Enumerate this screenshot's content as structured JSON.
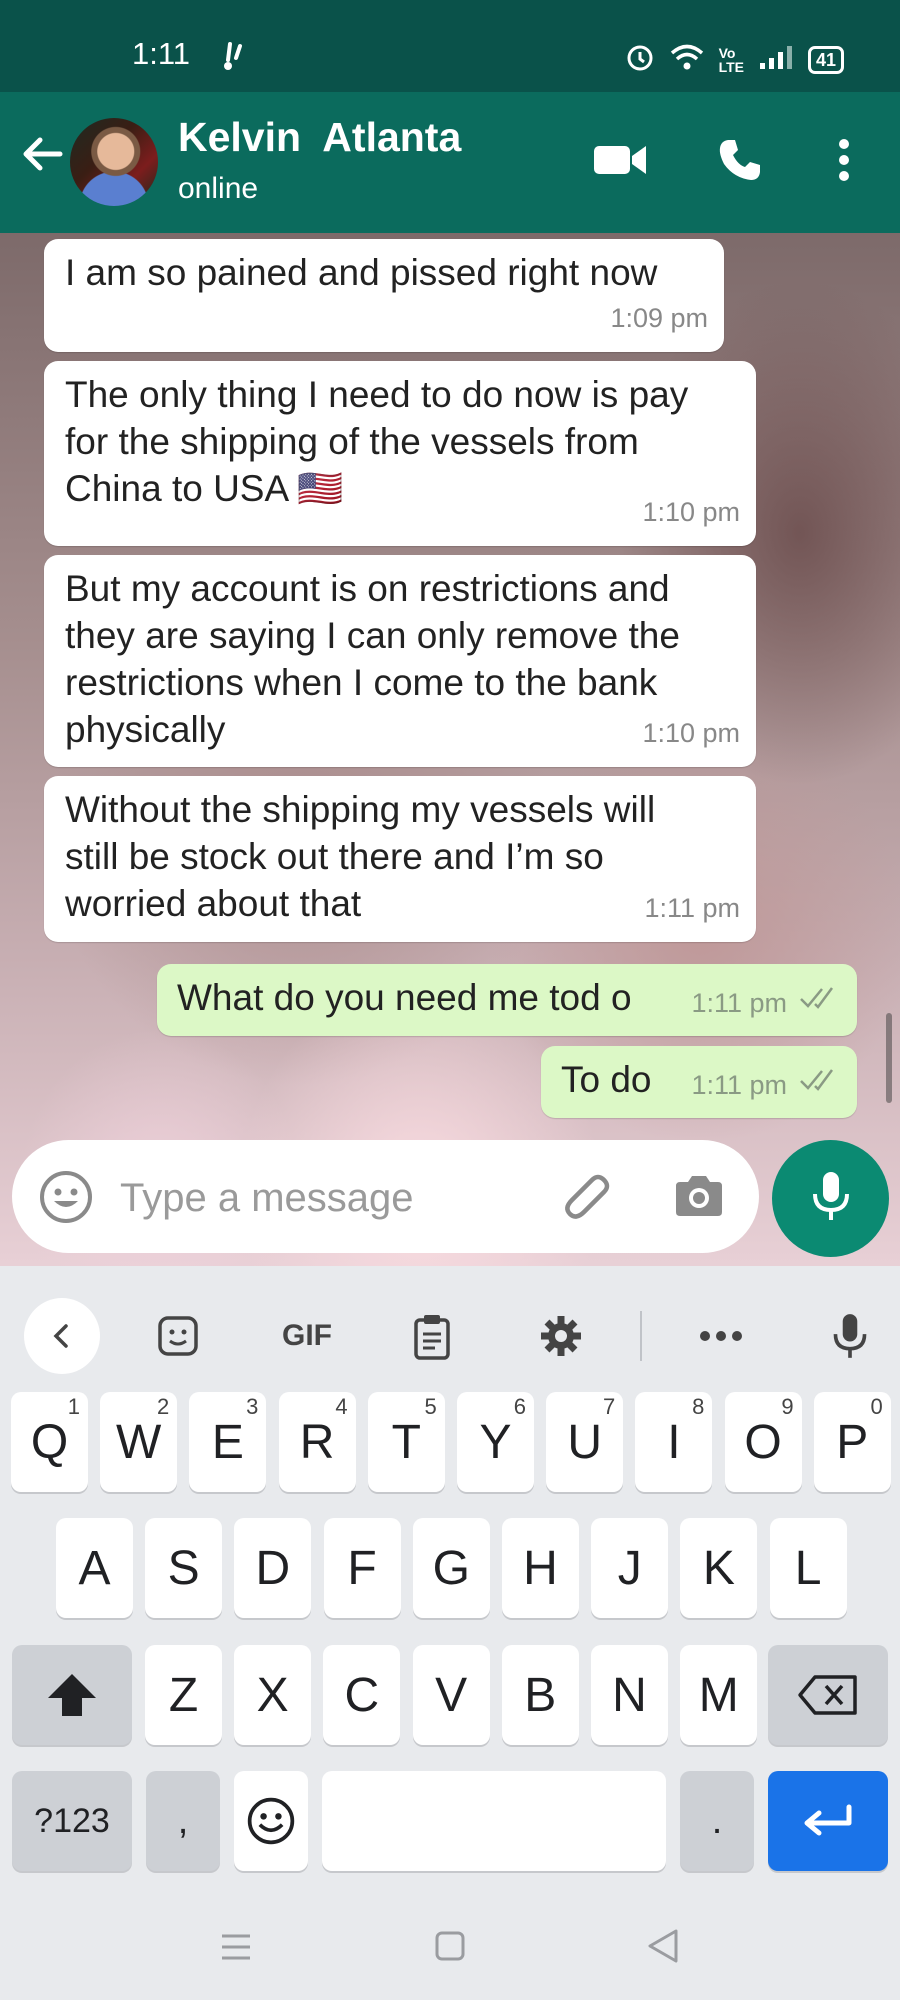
{
  "status_bar": {
    "time": "1:11",
    "battery": "41"
  },
  "header": {
    "contact_name": "Kelvin  Atlanta",
    "contact_status": "online"
  },
  "messages": [
    {
      "direction": "in",
      "text": "I am so pained and pissed right now",
      "time": "1:09 pm"
    },
    {
      "direction": "in",
      "text": "The only thing I need to do now is pay\nfor the shipping of the vessels from\nChina to USA 🇺🇸",
      "time": "1:10 pm"
    },
    {
      "direction": "in",
      "text": "But my account is on restrictions and\nthey are saying I can only remove the\nrestrictions when I come to the bank\nphysically",
      "time": "1:10 pm"
    },
    {
      "direction": "in",
      "text": "Without the shipping my vessels will\nstill be stock out there and I’m so\nworried about that",
      "time": "1:11 pm"
    },
    {
      "direction": "out",
      "text": "What do you need me tod o",
      "time": "1:11 pm"
    },
    {
      "direction": "out",
      "text": "To do",
      "time": "1:11 pm"
    }
  ],
  "composer": {
    "placeholder": "Type a message"
  },
  "keyboard": {
    "toolbar": {
      "gif": "GIF"
    },
    "row1": [
      {
        "k": "Q",
        "h": "1"
      },
      {
        "k": "W",
        "h": "2"
      },
      {
        "k": "E",
        "h": "3"
      },
      {
        "k": "R",
        "h": "4"
      },
      {
        "k": "T",
        "h": "5"
      },
      {
        "k": "Y",
        "h": "6"
      },
      {
        "k": "U",
        "h": "7"
      },
      {
        "k": "I",
        "h": "8"
      },
      {
        "k": "O",
        "h": "9"
      },
      {
        "k": "P",
        "h": "0"
      }
    ],
    "row2": [
      "A",
      "S",
      "D",
      "F",
      "G",
      "H",
      "J",
      "K",
      "L"
    ],
    "row3": [
      "Z",
      "X",
      "C",
      "V",
      "B",
      "N",
      "M"
    ],
    "symbols": "?123",
    "comma": ",",
    "period": "."
  }
}
